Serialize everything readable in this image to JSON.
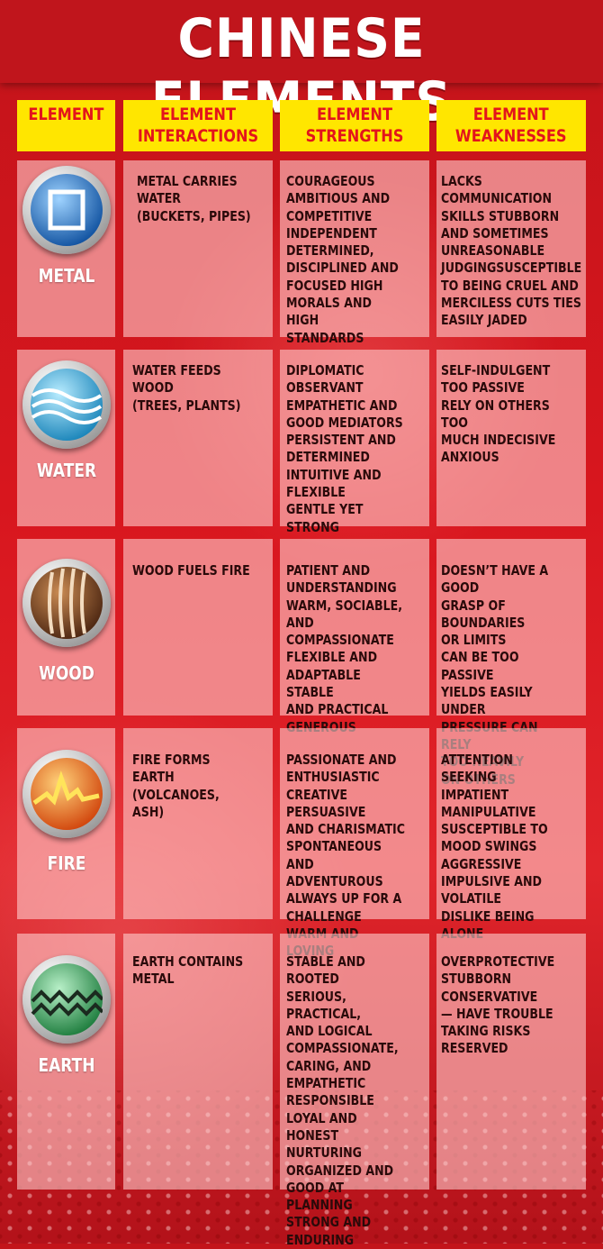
{
  "title": "CHINESE ELEMENTS",
  "headers": [
    "ELEMENT",
    "ELEMENT\nINTERACTIONS",
    "ELEMENT\nSTRENGTHS",
    "ELEMENT\nWEAKNESSES"
  ],
  "rows": [
    {
      "element": "METAL",
      "icon": "metal-icon",
      "interaction": "METAL CARRIES\nWATER\n(BUCKETS, PIPES)",
      "strengths": "COURAGEOUS\nAMBITIOUS AND\nCOMPETITIVE\nINDEPENDENT\nDETERMINED,\nDISCIPLINED AND\nFOCUSED HIGH\nMORALS AND HIGH\nSTANDARDS",
      "weaknesses": "LACKS\nCOMMUNICATION\nSKILLS STUBBORN\nAND SOMETIMES\nUNREASONABLE\nJUDGINGSUSCEPTIBLE\nTO BEING CRUEL AND\nMERCILESS CUTS TIES\nEASILY JADED"
    },
    {
      "element": "WATER",
      "icon": "water-icon",
      "interaction": "WATER FEEDS WOOD\n(TREES, PLANTS)",
      "strengths": "DIPLOMATIC\nOBSERVANT\nEMPATHETIC AND\nGOOD MEDIATORS\nPERSISTENT AND\nDETERMINED\nINTUITIVE AND\nFLEXIBLE\nGENTLE YET STRONG",
      "weaknesses": "SELF-INDULGENT\nTOO PASSIVE\nRELY ON OTHERS TOO\nMUCH INDECISIVE\nANXIOUS"
    },
    {
      "element": "WOOD",
      "icon": "wood-icon",
      "interaction": "WOOD FUELS FIRE",
      "strengths": "PATIENT AND\nUNDERSTANDING\nWARM, SOCIABLE,\nAND COMPASSIONATE\nFLEXIBLE AND\nADAPTABLE STABLE\nAND PRACTICAL\nGENEROUS",
      "weaknesses": "DOESN’T HAVE A GOOD\nGRASP OF BOUNDARIES\nOR LIMITS\nCAN BE TOO PASSIVE\nYIELDS EASILY UNDER\nPRESSURE CAN RELY\nTOO HEAVILY\nON OTHERS"
    },
    {
      "element": "FIRE",
      "icon": "fire-icon",
      "interaction": "FIRE FORMS EARTH\n(VOLCANOES, ASH)",
      "strengths": "PASSIONATE AND\nENTHUSIASTIC\nCREATIVE PERSUASIVE\nAND CHARISMATIC\nSPONTANEOUS AND\nADVENTUROUS\nALWAYS UP FOR A\nCHALLENGE\nWARM AND LOVING",
      "weaknesses": "ATTENTION SEEKING\nIMPATIENT\nMANIPULATIVE\nSUSCEPTIBLE TO\nMOOD SWINGS\nAGGRESSIVE\nIMPULSIVE AND\nVOLATILE\nDISLIKE BEING ALONE"
    },
    {
      "element": "EARTH",
      "icon": "earth-icon",
      "interaction": "EARTH CONTAINS\nMETAL",
      "strengths": "STABLE AND ROOTED\nSERIOUS, PRACTICAL,\nAND LOGICAL\nCOMPASSIONATE,\nCARING, AND\nEMPATHETIC\nRESPONSIBLE\nLOYAL AND HONEST\nNURTURING\nORGANIZED AND\nGOOD AT PLANNING\nSTRONG AND\nENDURING",
      "weaknesses": "OVERPROTECTIVE\nSTUBBORN\nCONSERVATIVE\n— HAVE TROUBLE\nTAKING RISKS\nRESERVED"
    }
  ],
  "colors": {
    "background": "#d8161e",
    "header_bg": "#ffe600",
    "header_text": "#e3141c",
    "cell_bg": "#ffcdcd",
    "body_text": "#2a0a0a"
  }
}
